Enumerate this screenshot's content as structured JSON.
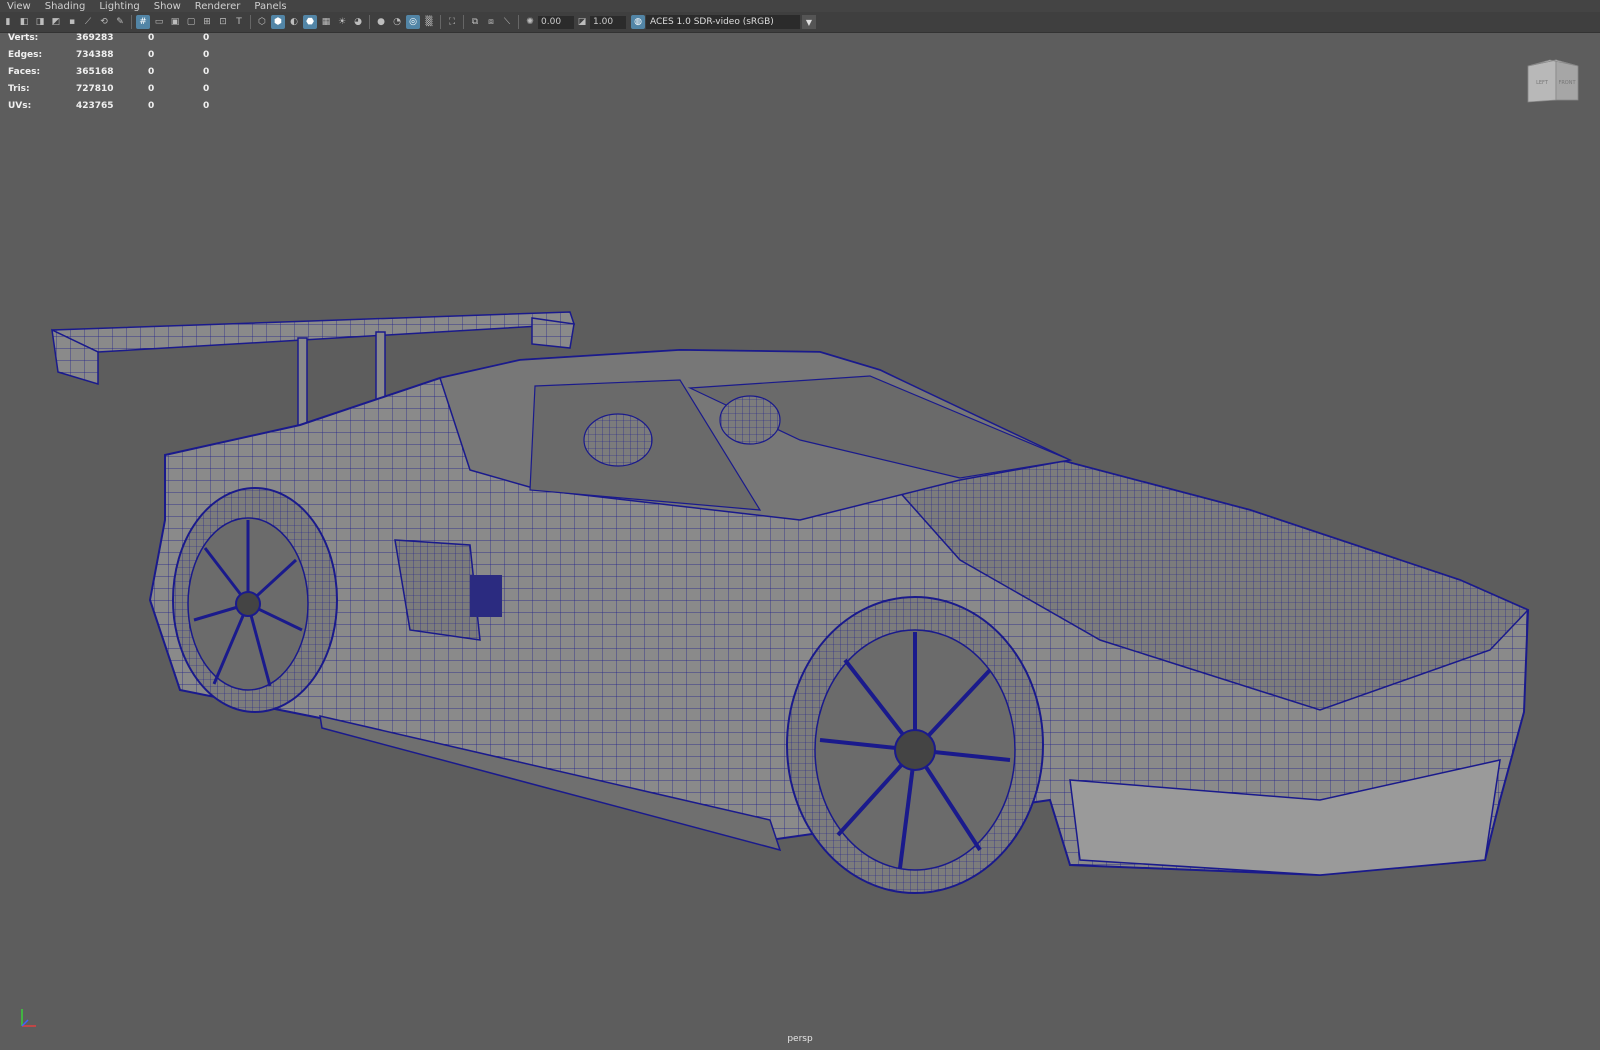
{
  "menu": [
    "View",
    "Shading",
    "Lighting",
    "Show",
    "Renderer",
    "Panels"
  ],
  "toolbar": {
    "exposure": "0.00",
    "gamma": "1.00",
    "color_space": "ACES 1.0 SDR-video (sRGB)"
  },
  "hud": [
    {
      "label": "Verts:",
      "value": "369283",
      "c2": "0",
      "c3": "0"
    },
    {
      "label": "Edges:",
      "value": "734388",
      "c2": "0",
      "c3": "0"
    },
    {
      "label": "Faces:",
      "value": "365168",
      "c2": "0",
      "c3": "0"
    },
    {
      "label": "Tris:",
      "value": "727810",
      "c2": "0",
      "c3": "0"
    },
    {
      "label": "UVs:",
      "value": "423765",
      "c2": "0",
      "c3": "0"
    }
  ],
  "viewcube": {
    "left": "LEFT",
    "front": "FRONT"
  },
  "camera": "persp",
  "colors": {
    "wire": "#1a1a8c",
    "background": "#5d5d5d",
    "toolbar_active": "#5285a6"
  }
}
